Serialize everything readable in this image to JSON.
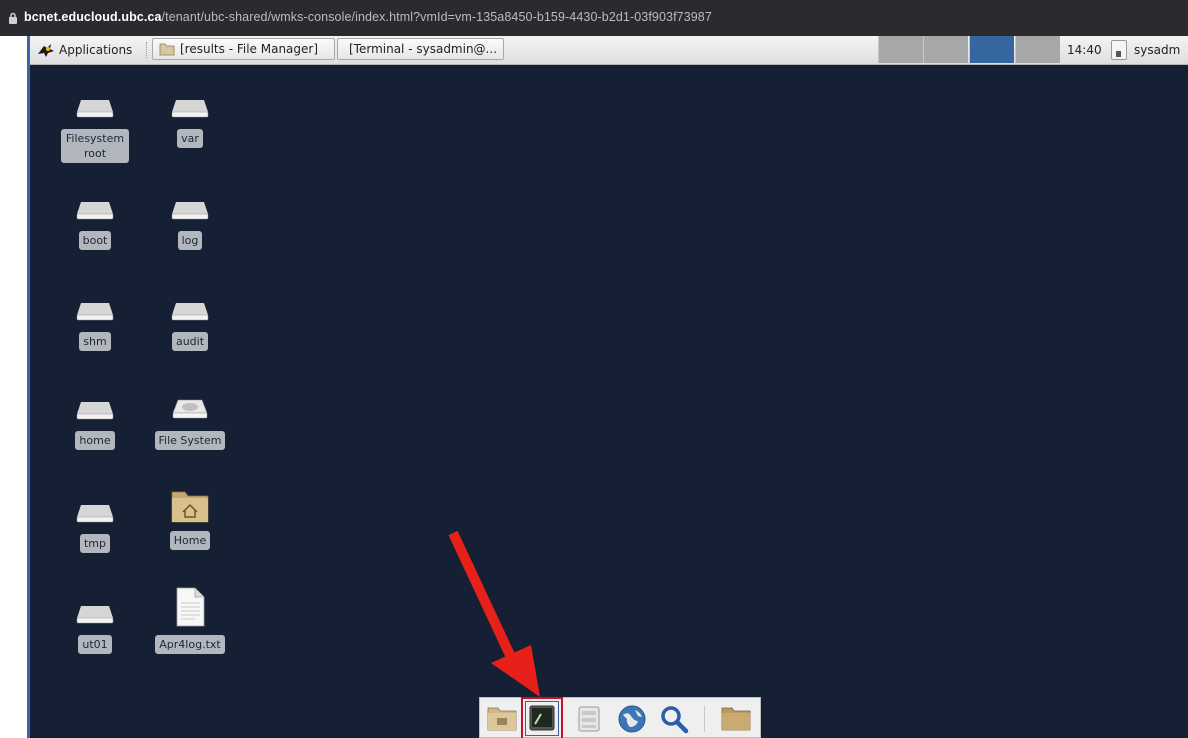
{
  "browser": {
    "url_host": "bcnet.educloud.ubc.ca",
    "url_path": "/tenant/ubc-shared/wmks-console/index.html?vmId=vm-135a8450-b159-4430-b2d1-03f903f73987",
    "lock_icon": "lock-icon"
  },
  "panel": {
    "app_menu_label": "Applications",
    "tasks": [
      {
        "label": "[results - File Manager]",
        "icon": "folder-icon"
      },
      {
        "label": "[Terminal - sysadmin@...",
        "icon": "terminal-icon"
      }
    ],
    "workspaces": 4,
    "active_workspace": 3,
    "clock": "14:40",
    "user": "sysadm"
  },
  "desktop": {
    "background_color": "#152035",
    "icons": [
      {
        "label": "Filesystem root",
        "kind": "drive"
      },
      {
        "label": "var",
        "kind": "drive"
      },
      {
        "label": "boot",
        "kind": "drive"
      },
      {
        "label": "log",
        "kind": "drive"
      },
      {
        "label": "shm",
        "kind": "drive"
      },
      {
        "label": "audit",
        "kind": "drive"
      },
      {
        "label": "home",
        "kind": "drive"
      },
      {
        "label": "File System",
        "kind": "filesystem"
      },
      {
        "label": "tmp",
        "kind": "drive"
      },
      {
        "label": "Home",
        "kind": "home-folder"
      },
      {
        "label": "ut01",
        "kind": "drive"
      },
      {
        "label": "Apr4log.txt",
        "kind": "text-file"
      }
    ]
  },
  "dock": {
    "items": [
      "show-desktop-icon",
      "terminal-icon",
      "file-manager-icon",
      "web-browser-icon",
      "search-icon",
      "folder-icon"
    ],
    "highlighted_item": "terminal-icon",
    "highlight_color": "#c8102e"
  },
  "annotation": {
    "arrow_color": "#e8201a"
  }
}
